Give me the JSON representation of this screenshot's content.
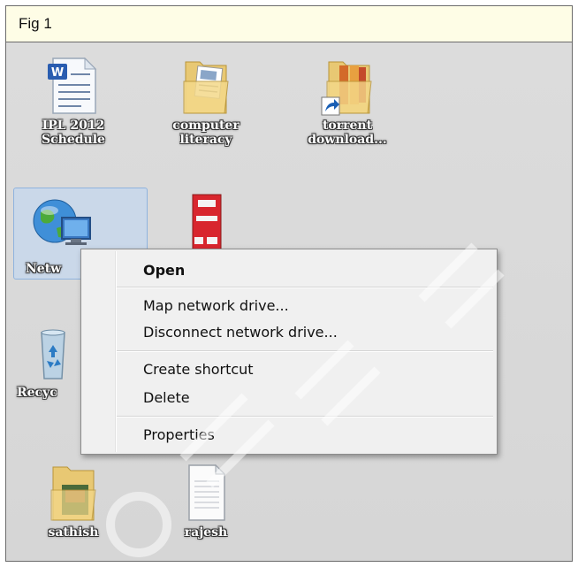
{
  "figure": {
    "label": "Fig 1"
  },
  "desktop_icons": [
    {
      "name": "doc",
      "line1": "IPL 2012",
      "line2": "Schedule"
    },
    {
      "name": "folder1",
      "line1": "computer",
      "line2": "literacy"
    },
    {
      "name": "folder2",
      "line1": "torrent",
      "line2": "download..."
    },
    {
      "name": "network",
      "line1": "Netw",
      "line2": ""
    },
    {
      "name": "book",
      "line1": "",
      "line2": ""
    },
    {
      "name": "recycle",
      "line1": "Recyc",
      "line2": ""
    },
    {
      "name": "sathish",
      "line1": "sathish",
      "line2": ""
    },
    {
      "name": "rajesh",
      "line1": "rajesh",
      "line2": ""
    }
  ],
  "context_menu": {
    "open": "Open",
    "map_drive": "Map network drive...",
    "disconnect_drive": "Disconnect network drive...",
    "create_shortcut": "Create shortcut",
    "delete": "Delete",
    "properties": "Properties"
  }
}
